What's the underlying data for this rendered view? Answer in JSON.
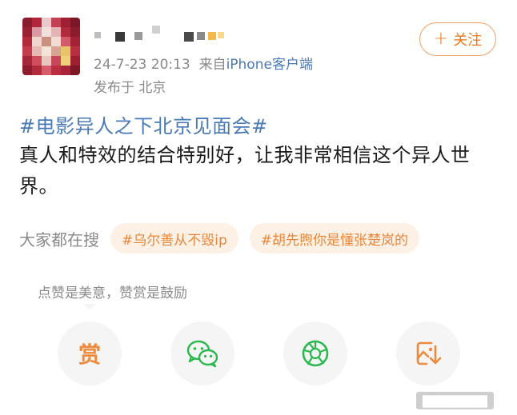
{
  "post": {
    "timestamp": "24-7-23 20:13",
    "source_prefix": "来自",
    "source": "iPhone客户端",
    "location": "发布于 北京",
    "topic": "#电影异人之下北京见面会#",
    "content": "真人和特效的结合特别好，让我非常相信这个异人世界。"
  },
  "follow_button": {
    "plus": "+",
    "label": "关注"
  },
  "search": {
    "label": "大家都在搜",
    "chips": [
      "#乌尔善从不毁ip",
      "#胡先煦你是懂张楚岚的"
    ]
  },
  "reward_tip": "点赞是美意，赞赏是鼓励",
  "actions": {
    "reward_label": "赏",
    "icons": [
      "reward-icon",
      "wechat-icon",
      "moments-icon",
      "save-image-icon"
    ]
  },
  "colors": {
    "accent_orange": "#ee7a1e",
    "link_blue": "#4a7ab5",
    "wechat_green": "#2cb84f"
  }
}
